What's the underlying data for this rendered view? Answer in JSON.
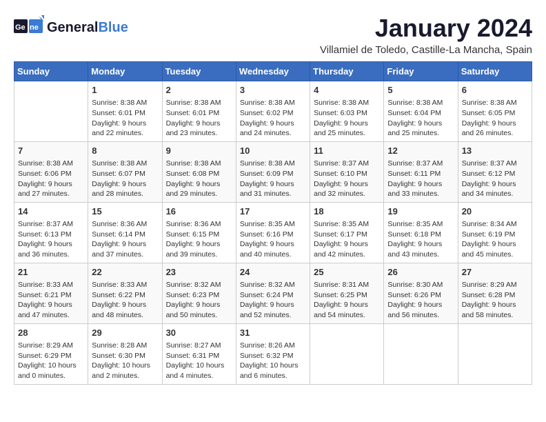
{
  "logo": {
    "general": "General",
    "blue": "Blue"
  },
  "header": {
    "title": "January 2024",
    "location": "Villamiel de Toledo, Castille-La Mancha, Spain"
  },
  "columns": [
    "Sunday",
    "Monday",
    "Tuesday",
    "Wednesday",
    "Thursday",
    "Friday",
    "Saturday"
  ],
  "weeks": [
    [
      {
        "day": "",
        "content": ""
      },
      {
        "day": "1",
        "content": "Sunrise: 8:38 AM\nSunset: 6:01 PM\nDaylight: 9 hours\nand 22 minutes."
      },
      {
        "day": "2",
        "content": "Sunrise: 8:38 AM\nSunset: 6:01 PM\nDaylight: 9 hours\nand 23 minutes."
      },
      {
        "day": "3",
        "content": "Sunrise: 8:38 AM\nSunset: 6:02 PM\nDaylight: 9 hours\nand 24 minutes."
      },
      {
        "day": "4",
        "content": "Sunrise: 8:38 AM\nSunset: 6:03 PM\nDaylight: 9 hours\nand 25 minutes."
      },
      {
        "day": "5",
        "content": "Sunrise: 8:38 AM\nSunset: 6:04 PM\nDaylight: 9 hours\nand 25 minutes."
      },
      {
        "day": "6",
        "content": "Sunrise: 8:38 AM\nSunset: 6:05 PM\nDaylight: 9 hours\nand 26 minutes."
      }
    ],
    [
      {
        "day": "7",
        "content": "Sunrise: 8:38 AM\nSunset: 6:06 PM\nDaylight: 9 hours\nand 27 minutes."
      },
      {
        "day": "8",
        "content": "Sunrise: 8:38 AM\nSunset: 6:07 PM\nDaylight: 9 hours\nand 28 minutes."
      },
      {
        "day": "9",
        "content": "Sunrise: 8:38 AM\nSunset: 6:08 PM\nDaylight: 9 hours\nand 29 minutes."
      },
      {
        "day": "10",
        "content": "Sunrise: 8:38 AM\nSunset: 6:09 PM\nDaylight: 9 hours\nand 31 minutes."
      },
      {
        "day": "11",
        "content": "Sunrise: 8:37 AM\nSunset: 6:10 PM\nDaylight: 9 hours\nand 32 minutes."
      },
      {
        "day": "12",
        "content": "Sunrise: 8:37 AM\nSunset: 6:11 PM\nDaylight: 9 hours\nand 33 minutes."
      },
      {
        "day": "13",
        "content": "Sunrise: 8:37 AM\nSunset: 6:12 PM\nDaylight: 9 hours\nand 34 minutes."
      }
    ],
    [
      {
        "day": "14",
        "content": "Sunrise: 8:37 AM\nSunset: 6:13 PM\nDaylight: 9 hours\nand 36 minutes."
      },
      {
        "day": "15",
        "content": "Sunrise: 8:36 AM\nSunset: 6:14 PM\nDaylight: 9 hours\nand 37 minutes."
      },
      {
        "day": "16",
        "content": "Sunrise: 8:36 AM\nSunset: 6:15 PM\nDaylight: 9 hours\nand 39 minutes."
      },
      {
        "day": "17",
        "content": "Sunrise: 8:35 AM\nSunset: 6:16 PM\nDaylight: 9 hours\nand 40 minutes."
      },
      {
        "day": "18",
        "content": "Sunrise: 8:35 AM\nSunset: 6:17 PM\nDaylight: 9 hours\nand 42 minutes."
      },
      {
        "day": "19",
        "content": "Sunrise: 8:35 AM\nSunset: 6:18 PM\nDaylight: 9 hours\nand 43 minutes."
      },
      {
        "day": "20",
        "content": "Sunrise: 8:34 AM\nSunset: 6:19 PM\nDaylight: 9 hours\nand 45 minutes."
      }
    ],
    [
      {
        "day": "21",
        "content": "Sunrise: 8:33 AM\nSunset: 6:21 PM\nDaylight: 9 hours\nand 47 minutes."
      },
      {
        "day": "22",
        "content": "Sunrise: 8:33 AM\nSunset: 6:22 PM\nDaylight: 9 hours\nand 48 minutes."
      },
      {
        "day": "23",
        "content": "Sunrise: 8:32 AM\nSunset: 6:23 PM\nDaylight: 9 hours\nand 50 minutes."
      },
      {
        "day": "24",
        "content": "Sunrise: 8:32 AM\nSunset: 6:24 PM\nDaylight: 9 hours\nand 52 minutes."
      },
      {
        "day": "25",
        "content": "Sunrise: 8:31 AM\nSunset: 6:25 PM\nDaylight: 9 hours\nand 54 minutes."
      },
      {
        "day": "26",
        "content": "Sunrise: 8:30 AM\nSunset: 6:26 PM\nDaylight: 9 hours\nand 56 minutes."
      },
      {
        "day": "27",
        "content": "Sunrise: 8:29 AM\nSunset: 6:28 PM\nDaylight: 9 hours\nand 58 minutes."
      }
    ],
    [
      {
        "day": "28",
        "content": "Sunrise: 8:29 AM\nSunset: 6:29 PM\nDaylight: 10 hours\nand 0 minutes."
      },
      {
        "day": "29",
        "content": "Sunrise: 8:28 AM\nSunset: 6:30 PM\nDaylight: 10 hours\nand 2 minutes."
      },
      {
        "day": "30",
        "content": "Sunrise: 8:27 AM\nSunset: 6:31 PM\nDaylight: 10 hours\nand 4 minutes."
      },
      {
        "day": "31",
        "content": "Sunrise: 8:26 AM\nSunset: 6:32 PM\nDaylight: 10 hours\nand 6 minutes."
      },
      {
        "day": "",
        "content": ""
      },
      {
        "day": "",
        "content": ""
      },
      {
        "day": "",
        "content": ""
      }
    ]
  ]
}
